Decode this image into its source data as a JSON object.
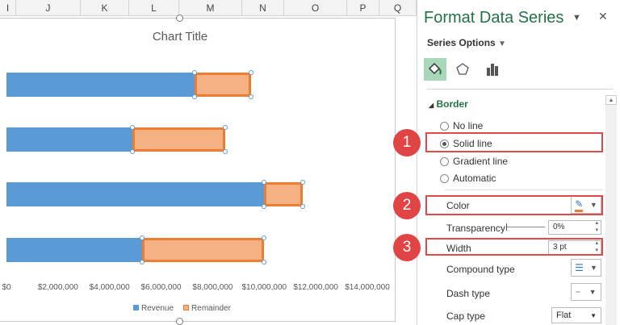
{
  "columns": [
    "I",
    "J",
    "K",
    "L",
    "M",
    "N",
    "O",
    "P",
    "Q"
  ],
  "chart": {
    "title": "Chart Title",
    "x_ticks": [
      "$0",
      "$2,000,000",
      "$4,000,000",
      "$6,000,000",
      "$8,000,000",
      "$10,000,000",
      "$12,000,000",
      "$14,000,000"
    ],
    "legend": [
      "Revenue",
      "Remainder"
    ],
    "colors": {
      "revenue": "#5b9bd5",
      "remainder_fill": "#f4b183",
      "remainder_border": "#ed7d31"
    }
  },
  "chart_data": {
    "type": "bar",
    "orientation": "horizontal",
    "stacked": true,
    "title": "Chart Title",
    "xlim": [
      0,
      14000000
    ],
    "series": [
      {
        "name": "Revenue",
        "values": [
          7300000,
          4900000,
          10000000,
          5250000
        ]
      },
      {
        "name": "Remainder",
        "values": [
          2200000,
          3600000,
          1500000,
          4750000
        ]
      }
    ],
    "legend_position": "bottom"
  },
  "pane": {
    "title": "Format Data Series",
    "series_options": "Series Options",
    "section": "Border",
    "radios": [
      {
        "label": "No line",
        "checked": false
      },
      {
        "label": "Solid line",
        "checked": true
      },
      {
        "label": "Gradient line",
        "checked": false
      },
      {
        "label": "Automatic",
        "checked": false
      }
    ],
    "color_label": "Color",
    "transparency_label": "Transparency",
    "transparency_value": "0%",
    "width_label": "Width",
    "width_value": "3 pt",
    "compound_label": "Compound type",
    "dash_label": "Dash type",
    "cap_label": "Cap type",
    "cap_value": "Flat"
  },
  "callouts": [
    "1",
    "2",
    "3"
  ]
}
